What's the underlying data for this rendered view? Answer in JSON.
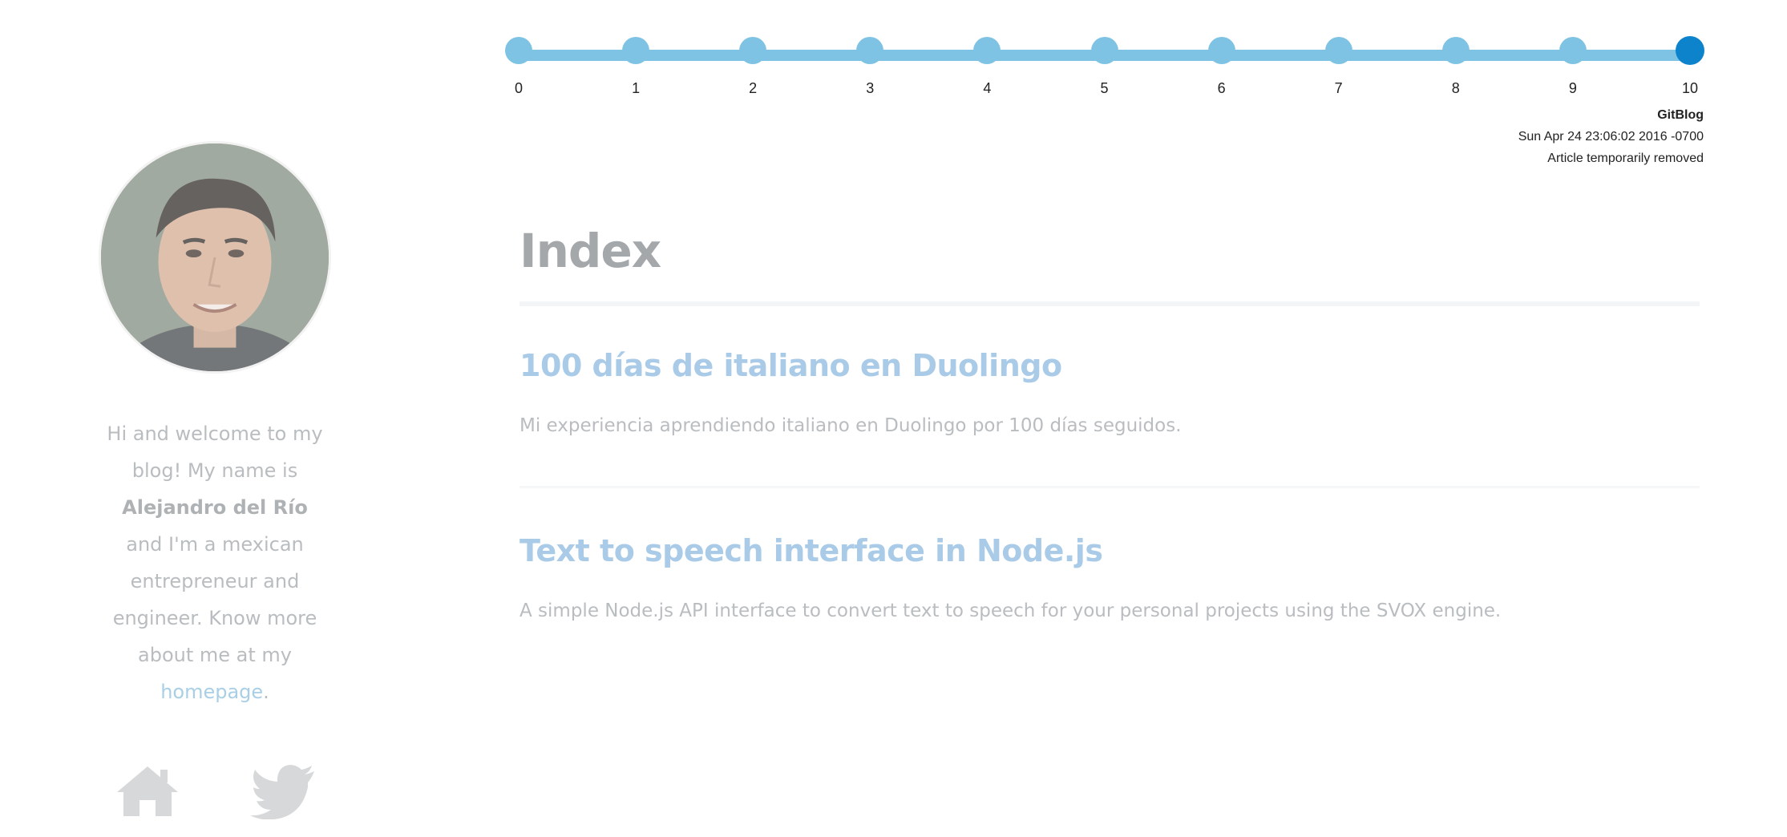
{
  "sidebar": {
    "bio": {
      "intro": "Hi and welcome to my blog! My name is ",
      "name": "Alejandro del Río",
      "after_name": " and I'm a mexican entrepreneur and engineer. Know more about me at my ",
      "link_text": "homepage",
      "end": "."
    },
    "social": [
      {
        "icon": "home-icon"
      },
      {
        "icon": "twitter-icon"
      }
    ]
  },
  "timeline": {
    "ticks": [
      "0",
      "1",
      "2",
      "3",
      "4",
      "5",
      "6",
      "7",
      "8",
      "9",
      "10"
    ],
    "active_index": 10,
    "commit": {
      "repo": "GitBlog",
      "date": "Sun Apr 24 23:06:02 2016 -0700",
      "message": "Article temporarily removed"
    }
  },
  "main": {
    "title": "Index",
    "posts": [
      {
        "title": "100 días de italiano en Duolingo",
        "excerpt": "Mi experiencia aprendiendo italiano en Duolingo por 100 días seguidos."
      },
      {
        "title": "Text to speech interface in Node.js",
        "excerpt": "A simple Node.js API interface to convert text to speech for your personal projects using the SVOX engine."
      }
    ]
  },
  "colors": {
    "timeline_track": "#7fc3e4",
    "timeline_active": "#0d83cc",
    "post_title": "#a9cbe8",
    "link": "#a9cfe6",
    "muted_text": "#b9bdc0"
  }
}
